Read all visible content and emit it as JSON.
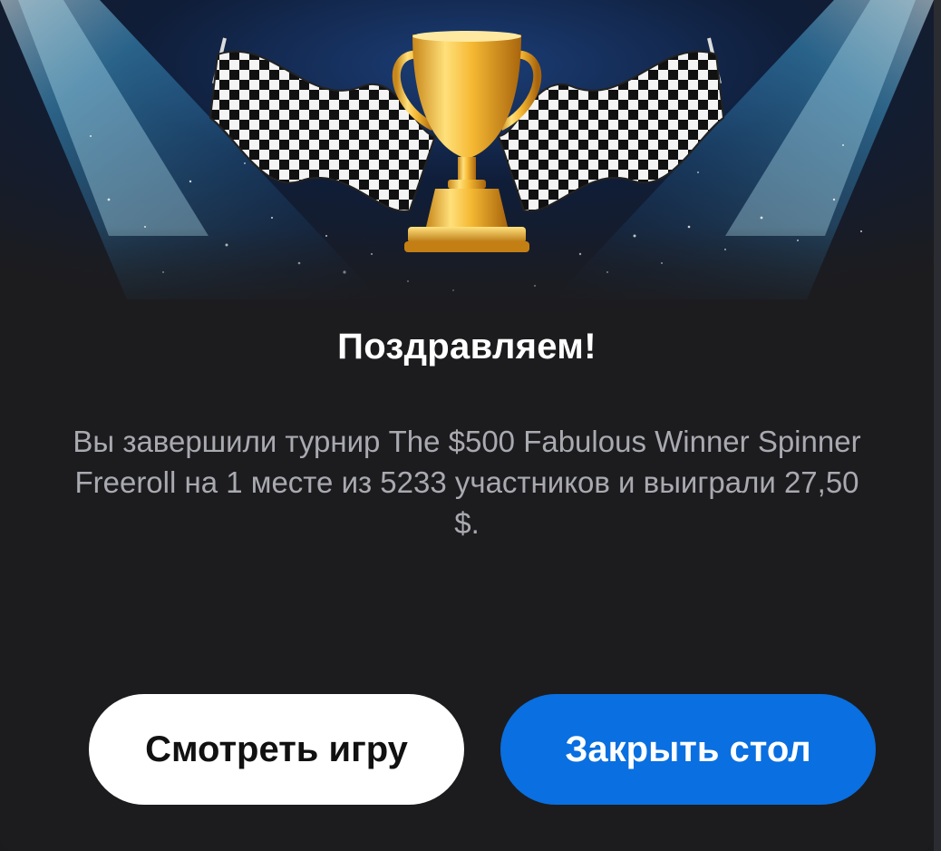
{
  "dialog": {
    "title": "Поздравляем!",
    "message": "Вы завершили турнир The $500 Fabulous Winner Spinner Freeroll на 1 месте из 5233 участников и выиграли 27,50 $.",
    "buttons": {
      "watch_label": "Смотреть игру",
      "close_label": "Закрыть стол"
    }
  },
  "icons": [
    "trophy-icon",
    "checkered-flag-icon"
  ],
  "colors": {
    "background": "#1c1c1f",
    "title": "#ffffff",
    "message": "#a9aab0",
    "primary_button": "#0a6fe0",
    "secondary_button": "#ffffff",
    "trophy_gold": "#f2b630"
  }
}
